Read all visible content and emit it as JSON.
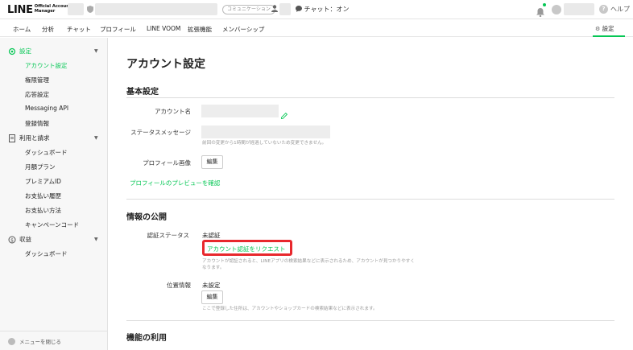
{
  "topbar": {
    "logo_main": "LINE",
    "logo_sub": "Official Account Manager",
    "comm_badge": "コミュニケーション",
    "chat_status": "チャット：オン",
    "help_label": "ヘルプ"
  },
  "nav": {
    "items": [
      "ホーム",
      "分析",
      "チャット",
      "プロフィール",
      "LINE VOOM",
      "拡張機能",
      "メンバーシップ"
    ],
    "settings_label": "設定"
  },
  "sidebar": {
    "group_settings": "設定",
    "settings_items": [
      "アカウント設定",
      "権限管理",
      "応答設定",
      "Messaging API",
      "登録情報"
    ],
    "group_billing": "利用と請求",
    "billing_items": [
      "ダッシュボード",
      "月額プラン",
      "プレミアムID",
      "お支払い履歴",
      "お支払い方法",
      "キャンペーンコード"
    ],
    "group_revenue": "収益",
    "revenue_items": [
      "ダッシュボード"
    ],
    "close_menu": "メニューを閉じる"
  },
  "main": {
    "page_title": "アカウント設定",
    "basic": {
      "title": "基本設定",
      "account_name_label": "アカウント名",
      "status_message_label": "ステータスメッセージ",
      "status_hint": "前回の変更から1時間が経過していないため変更できません。",
      "profile_image_label": "プロフィール画像",
      "edit_label": "編集",
      "preview_link": "プロフィールのプレビューを確認"
    },
    "public": {
      "title": "情報の公開",
      "verify_label": "認証ステータス",
      "verify_value": "未認証",
      "request_link": "アカウント認証をリクエスト",
      "verify_hint_1": "アカウントが認証されると、LINEアプリの検索結果などに表示されるため、アカウントが見つかりやすく",
      "verify_hint_2": "なります。",
      "location_label": "位置情報",
      "location_value": "未設定",
      "edit_label": "編集",
      "location_hint": "ここで登録した住所は、アカウントやショップカードの検索結果などに表示されます。"
    },
    "features": {
      "title": "機能の利用"
    }
  },
  "colors": {
    "accent": "#06c755",
    "highlight": "#e8282d"
  }
}
